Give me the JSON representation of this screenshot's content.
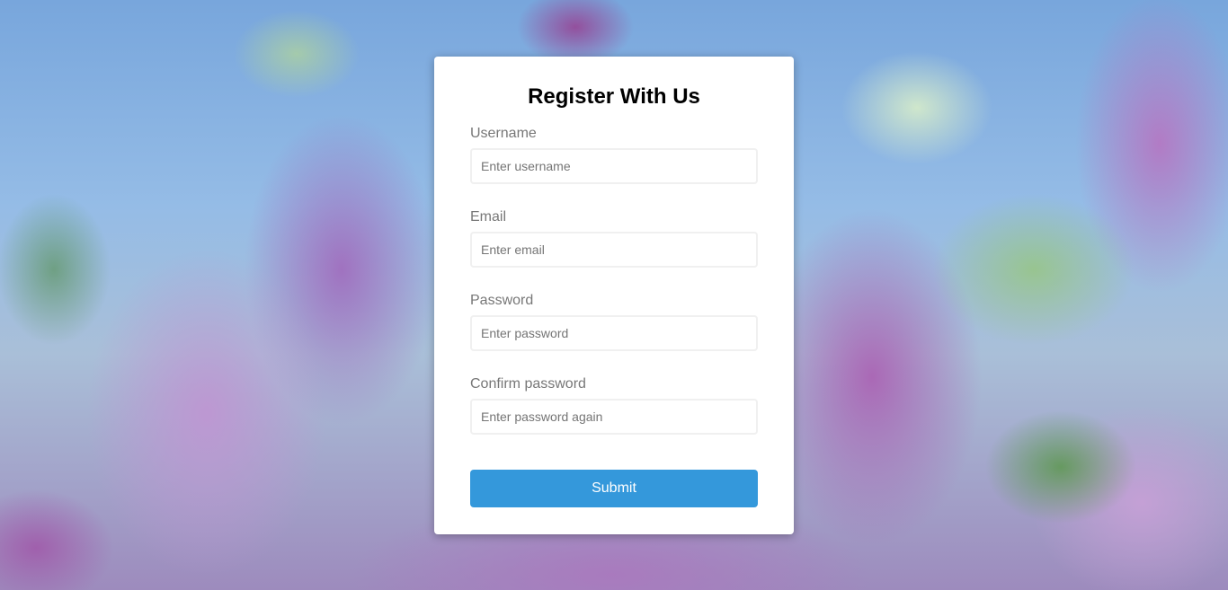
{
  "form": {
    "title": "Register With Us",
    "fields": [
      {
        "label": "Username",
        "placeholder": "Enter username",
        "value": ""
      },
      {
        "label": "Email",
        "placeholder": "Enter email",
        "value": ""
      },
      {
        "label": "Password",
        "placeholder": "Enter password",
        "value": ""
      },
      {
        "label": "Confirm password",
        "placeholder": "Enter password again",
        "value": ""
      }
    ],
    "submit_label": "Submit"
  },
  "colors": {
    "accent": "#3498db",
    "card_background": "#ffffff",
    "label_text": "#777777"
  }
}
